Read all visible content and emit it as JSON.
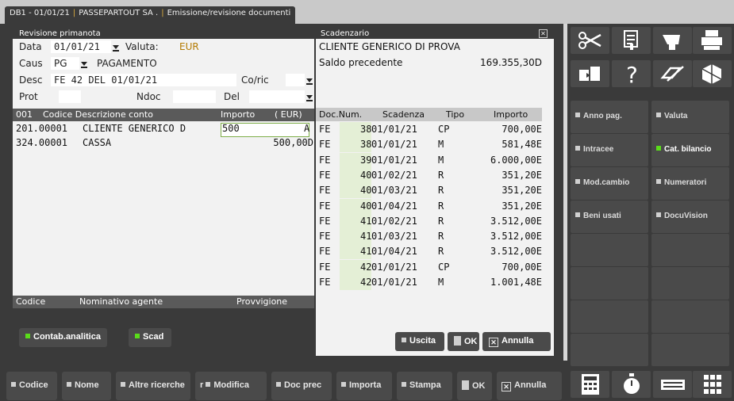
{
  "window": {
    "code": "DB1 - 01/01/21",
    "company": "PASSEPARTOUT SA .",
    "title": "Emissione/revisione documenti"
  },
  "prima_nota": {
    "title": "Revisione primanota",
    "data_label": "Data",
    "data_value": "01/01/21",
    "valuta_label": "Valuta:",
    "valuta_value": "EUR",
    "caus_label": "Caus",
    "caus_code": "PG",
    "caus_desc": "PAGAMENTO",
    "desc_label": "Desc",
    "desc_value": "FE 42 DEL 01/01/21",
    "coric_label": "Co/ric",
    "prot_label": "Prot",
    "ndoc_label": "Ndoc",
    "del_label": "Del",
    "grid_header": {
      "row": "001",
      "codice": "Codice Descrizione conto",
      "importo": "Importo",
      "currency": "( EUR)"
    },
    "rows": [
      {
        "code": "201.00001",
        "desc": "CLIENTE GENERICO D",
        "amount": "500",
        "flag": "A"
      },
      {
        "code": "324.00001",
        "desc": "CASSA",
        "amount": "500,00D",
        "flag": ""
      }
    ],
    "agent_header": {
      "codice": "Codice",
      "nominativo": "Nominativo agente",
      "provvigione": "Provvigione"
    },
    "buttons": {
      "contab": "Contab.analitica",
      "scad": "Scad"
    }
  },
  "scadenzario": {
    "title": "Scadenzario",
    "client": "CLIENTE GENERICO DI PROVA",
    "saldo_label": "Saldo precedente",
    "saldo_value": "169.355,30D",
    "header": {
      "doc": "Doc.Num.",
      "scadenza": "Scadenza",
      "tipo": "Tipo",
      "importo": "Importo"
    },
    "rows": [
      {
        "doc": "FE",
        "num": "38",
        "date": "01/01/21",
        "tipo": "CP",
        "importo": "700,00E"
      },
      {
        "doc": "FE",
        "num": "38",
        "date": "01/01/21",
        "tipo": "M",
        "importo": "581,48E"
      },
      {
        "doc": "FE",
        "num": "39",
        "date": "01/01/21",
        "tipo": "M",
        "importo": "6.000,00E"
      },
      {
        "doc": "FE",
        "num": "40",
        "date": "01/02/21",
        "tipo": "R",
        "importo": "351,20E"
      },
      {
        "doc": "FE",
        "num": "40",
        "date": "01/03/21",
        "tipo": "R",
        "importo": "351,20E"
      },
      {
        "doc": "FE",
        "num": "40",
        "date": "01/04/21",
        "tipo": "R",
        "importo": "351,20E"
      },
      {
        "doc": "FE",
        "num": "41",
        "date": "01/02/21",
        "tipo": "R",
        "importo": "3.512,00E"
      },
      {
        "doc": "FE",
        "num": "41",
        "date": "01/03/21",
        "tipo": "R",
        "importo": "3.512,00E"
      },
      {
        "doc": "FE",
        "num": "41",
        "date": "01/04/21",
        "tipo": "R",
        "importo": "3.512,00E"
      },
      {
        "doc": "FE",
        "num": "42",
        "date": "01/01/21",
        "tipo": "CP",
        "importo": "700,00E"
      },
      {
        "doc": "FE",
        "num": "42",
        "date": "01/01/21",
        "tipo": "M",
        "importo": "1.001,48E"
      }
    ],
    "buttons": {
      "uscita": "Uscita",
      "ok": "OK",
      "annulla": "Annulla"
    }
  },
  "toolbar": {
    "icons": [
      "scissors-icon",
      "paste-icon",
      "eraser-icon",
      "printer-icon",
      "window-switch-icon",
      "help-icon",
      "edit-icon",
      "cube-icon"
    ],
    "help_glyph": "?",
    "functions": [
      {
        "label": "Anno pag.",
        "active": false
      },
      {
        "label": "Valuta",
        "active": false
      },
      {
        "label": "Intracee",
        "active": false
      },
      {
        "label": "Cat. bilancio",
        "active": true
      },
      {
        "label": "Mod.cambio",
        "active": false
      },
      {
        "label": "Numeratori",
        "active": false
      },
      {
        "label": "Beni usati",
        "active": false
      },
      {
        "label": "DocuVision",
        "active": false
      }
    ],
    "bottom_icons": [
      "calculator-icon",
      "stopwatch-icon",
      "keyboard-icon",
      "grid-icon"
    ]
  },
  "bottom_bar": {
    "codice": "Codice",
    "nome": "Nome",
    "altre_ricerche": "Altre ricerche",
    "modifica_prefix": "r",
    "modifica": "Modifica",
    "doc_prec": "Doc prec",
    "importa": "Importa",
    "stampa": "Stampa",
    "ok": "OK",
    "annulla": "Annulla"
  },
  "colors": {
    "accent": "#5adc1a",
    "dark": "#3a3a3a",
    "panel": "#f2f2f2",
    "amount_highlight": "#e4efd6"
  }
}
